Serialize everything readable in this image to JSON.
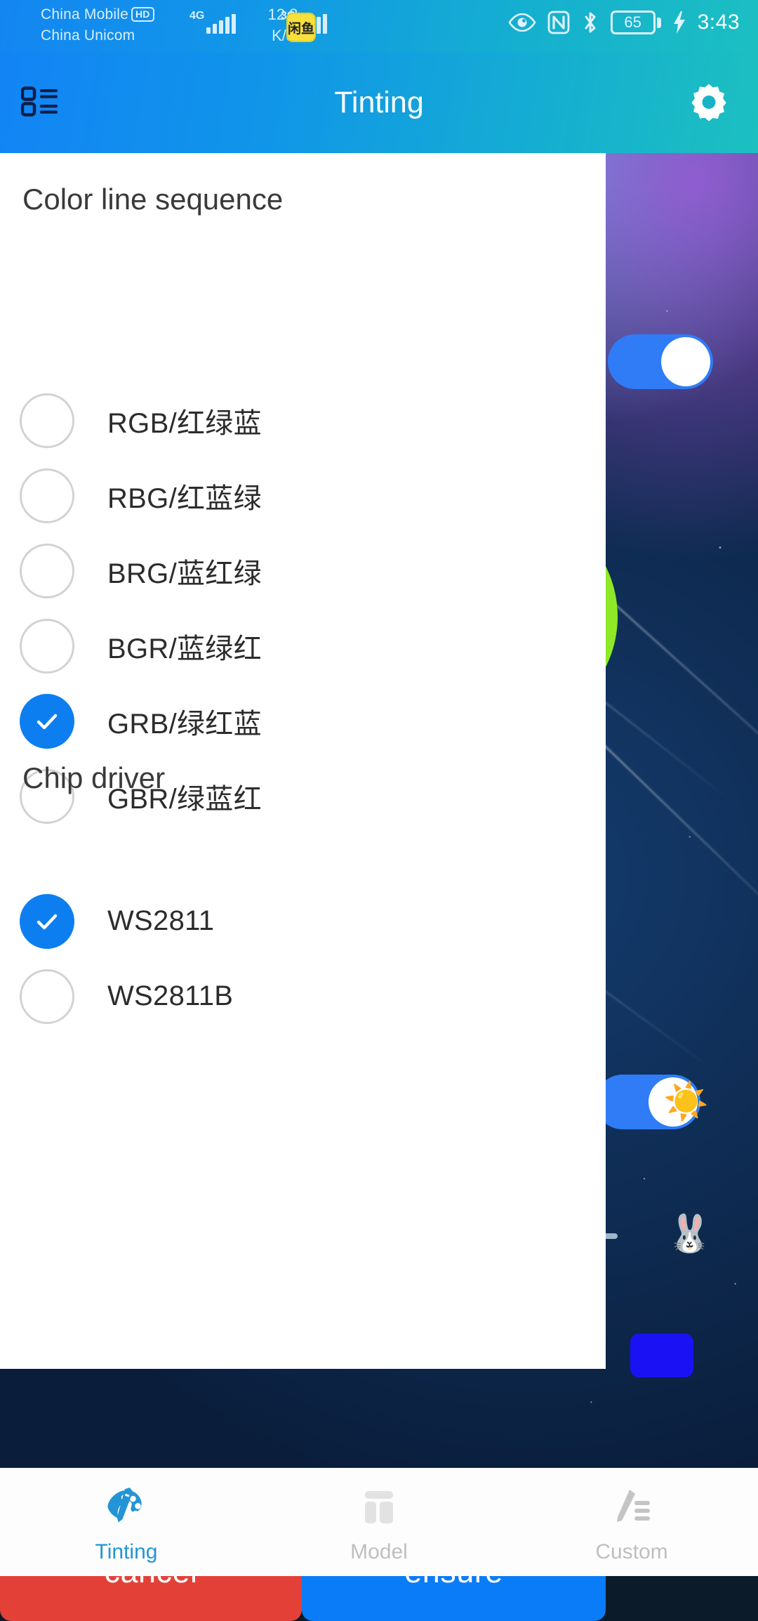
{
  "statusbar": {
    "carrier_line1": "China Mobile",
    "carrier_line2": "China Unicom",
    "hd_badge": "HD",
    "net_type_1": "4G",
    "net_type_2": "3G",
    "net_speed_value": "12.8",
    "net_speed_unit": "K/s",
    "app_badge_text": "闲鱼",
    "battery_percent": "65",
    "clock": "3:43",
    "icons": [
      "eye-protect-icon",
      "nfc-icon",
      "bluetooth-icon",
      "battery-icon",
      "charging-bolt-icon"
    ]
  },
  "appbar": {
    "title": "Tinting",
    "left_icon": "list-menu-icon",
    "right_icon": "gear-icon"
  },
  "dialog": {
    "color_section_title": "Color line sequence",
    "color_options": [
      {
        "label": "RGB/红绿蓝",
        "selected": false
      },
      {
        "label": "RBG/红蓝绿",
        "selected": false
      },
      {
        "label": "BRG/蓝红绿",
        "selected": false
      },
      {
        "label": "BGR/蓝绿红",
        "selected": false
      },
      {
        "label": "GRB/绿红蓝",
        "selected": true
      },
      {
        "label": "GBR/绿蓝红",
        "selected": false
      }
    ],
    "chip_section_title": "Chip driver",
    "chip_options": [
      {
        "label": "WS2811",
        "selected": true
      },
      {
        "label": "WS2811B",
        "selected": false
      }
    ],
    "cancel_label": "cancel",
    "ensure_label": "ensure"
  },
  "bottomnav": {
    "items": [
      {
        "label": "Tinting",
        "icon": "palette-brush-icon",
        "active": true
      },
      {
        "label": "Model",
        "icon": "layout-template-icon",
        "active": false
      },
      {
        "label": "Custom",
        "icon": "pencil-lines-icon",
        "active": false
      }
    ]
  },
  "colors": {
    "accent_blue": "#0d7ef0",
    "cancel_red": "#e34138",
    "ensure_blue": "#0a7cf7",
    "nav_active": "#2394d6",
    "nav_inactive": "#bfbfbf"
  }
}
